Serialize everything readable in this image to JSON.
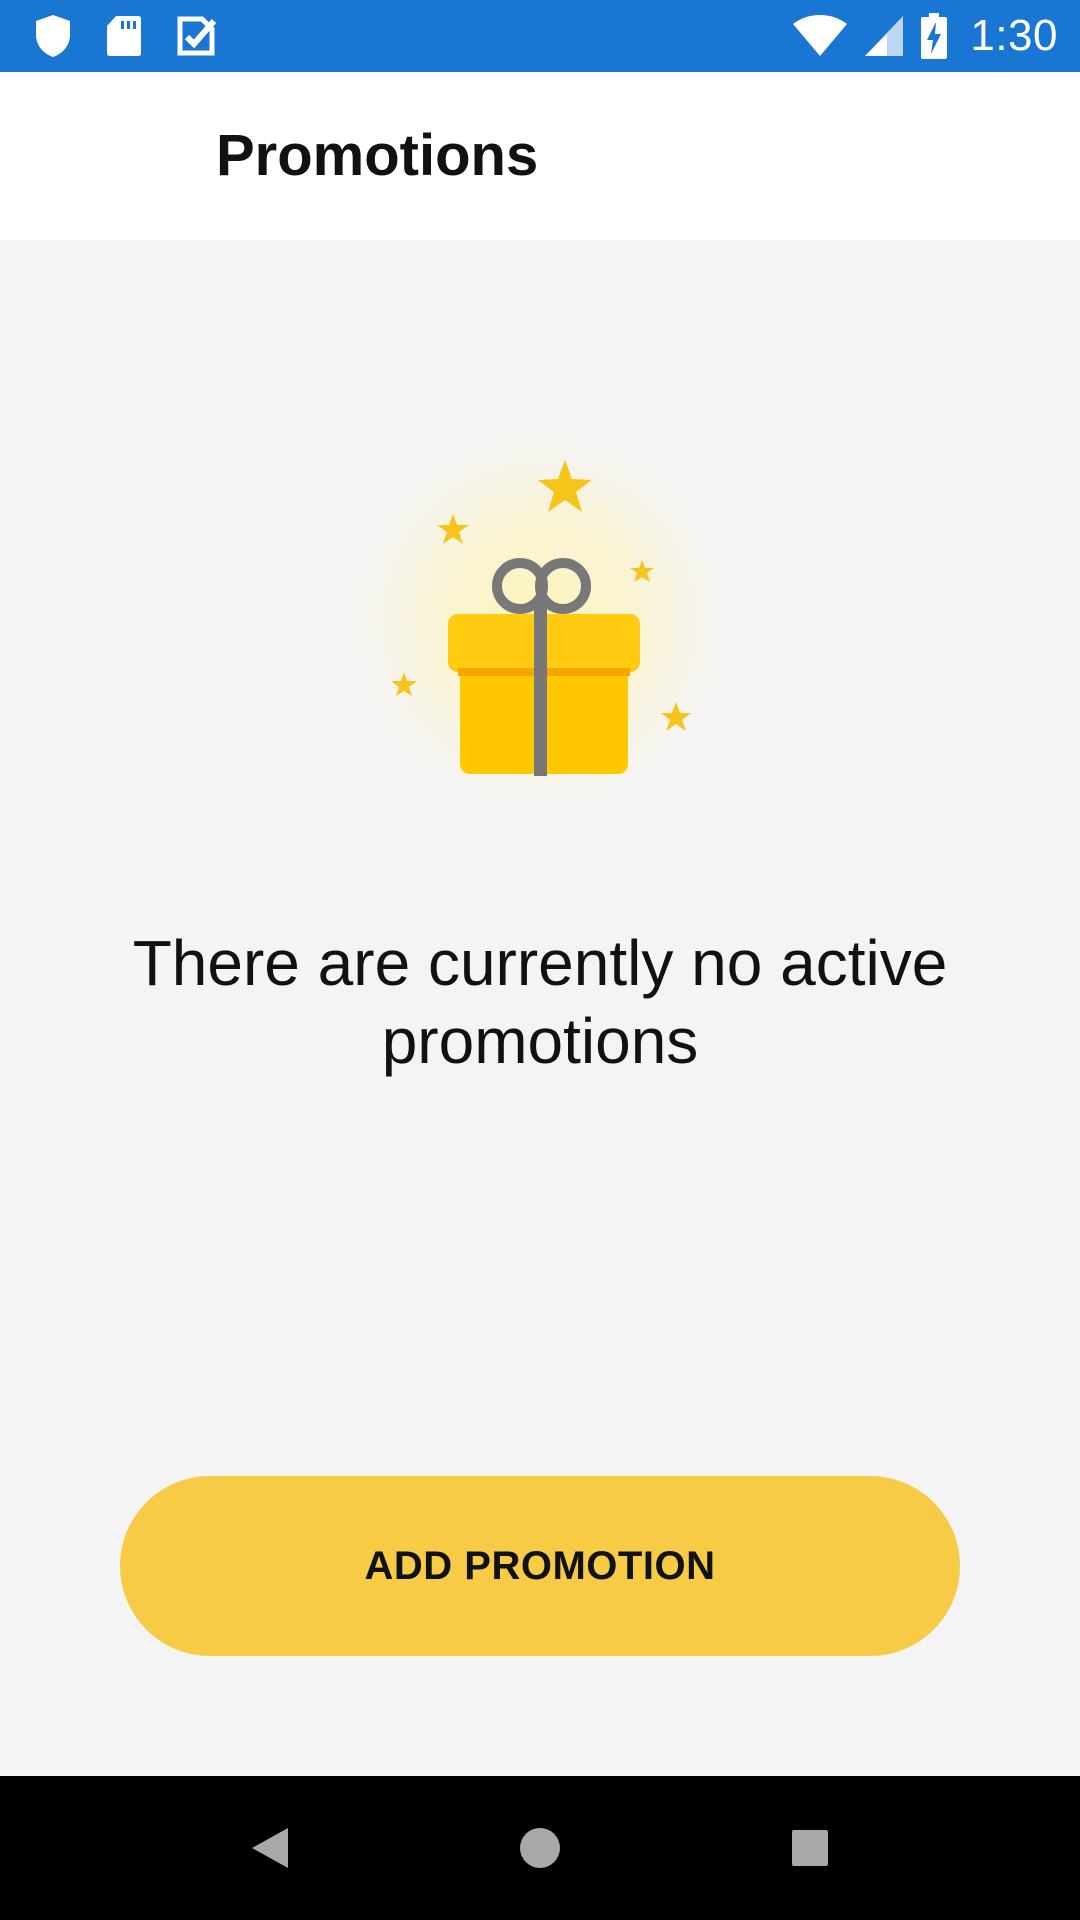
{
  "status_bar": {
    "left_icons": [
      "shield-icon",
      "sd-card-icon",
      "clipboard-check-icon"
    ],
    "right_icons": [
      "wifi-icon",
      "signal-icon",
      "battery-charging-icon"
    ],
    "time": "1:30",
    "background_color": "#1976d2"
  },
  "app_bar": {
    "title": "Promotions"
  },
  "empty_state": {
    "icon": "gift-icon",
    "message": "There are currently no active promotions"
  },
  "actions": {
    "add_promotion_label": "ADD PROMOTION",
    "button_color": "#f7cb46"
  },
  "nav_bar": {
    "items": [
      "back-icon",
      "home-icon",
      "recents-icon"
    ]
  }
}
